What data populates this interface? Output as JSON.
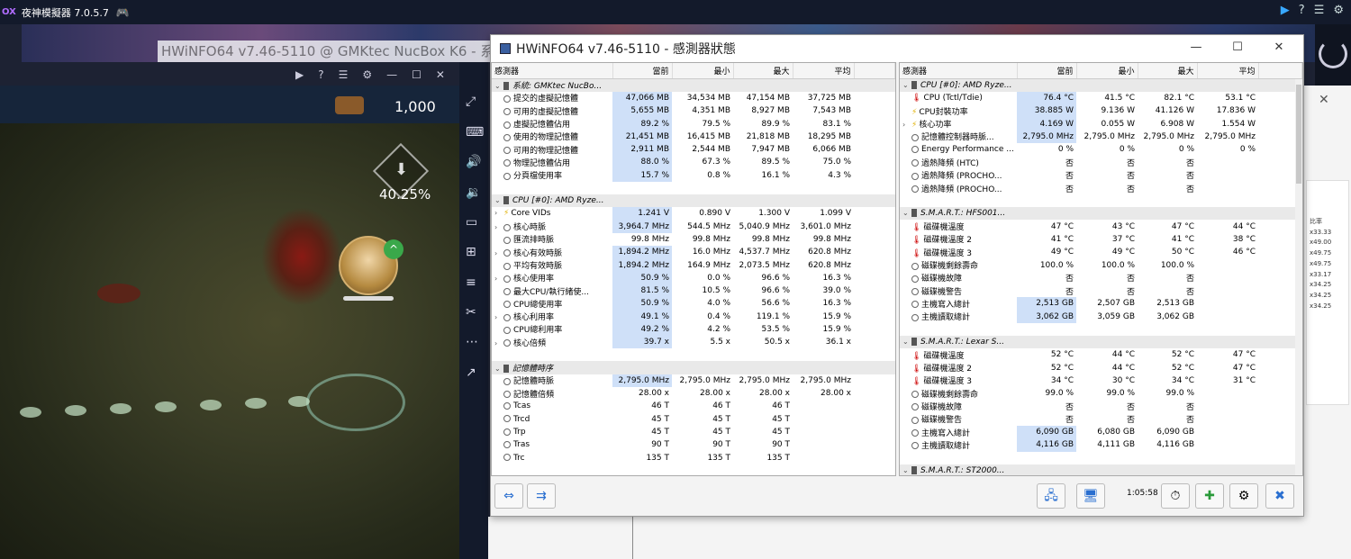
{
  "emulator": {
    "logo": "OX",
    "title": "夜神模擬器 7.0.5.7"
  },
  "game": {
    "gold": "1,000",
    "progress_text": "40.25%"
  },
  "mini_window": {
    "title": "HWiNFO64 v7.46-5110 @ GMKtec NucBox K6 - 系統"
  },
  "hwinfo": {
    "title": "HWiNFO64 v7.46-5110 - 感測器狀態",
    "columns": [
      "感測器",
      "當前",
      "最小",
      "最大",
      "平均"
    ],
    "time": "1:05:58",
    "left_rows": [
      {
        "t": "grp",
        "label": "系統: GMKtec NucBo..."
      },
      {
        "label": "提交的虛擬記憶體",
        "cur": "47,066 MB",
        "min": "34,534 MB",
        "max": "47,154 MB",
        "avg": "37,725 MB",
        "hl": true
      },
      {
        "label": "可用的虛擬記憶體",
        "cur": "5,655 MB",
        "min": "4,351 MB",
        "max": "8,927 MB",
        "avg": "7,543 MB",
        "hl": true
      },
      {
        "label": "虛擬記憶體佔用",
        "cur": "89.2 %",
        "min": "79.5 %",
        "max": "89.9 %",
        "avg": "83.1 %",
        "hl": true
      },
      {
        "label": "使用的物理記憶體",
        "cur": "21,451 MB",
        "min": "16,415 MB",
        "max": "21,818 MB",
        "avg": "18,295 MB",
        "hl": true
      },
      {
        "label": "可用的物理記憶體",
        "cur": "2,911 MB",
        "min": "2,544 MB",
        "max": "7,947 MB",
        "avg": "6,066 MB",
        "hl": true
      },
      {
        "label": "物理記憶體佔用",
        "cur": "88.0 %",
        "min": "67.3 %",
        "max": "89.5 %",
        "avg": "75.0 %",
        "hl": true
      },
      {
        "label": "分頁檔使用率",
        "cur": "15.7 %",
        "min": "0.8 %",
        "max": "16.1 %",
        "avg": "4.3 %",
        "hl": true
      },
      {
        "t": "blank"
      },
      {
        "t": "grp",
        "label": "CPU [#0]: AMD Ryze..."
      },
      {
        "label": "Core VIDs",
        "cur": "1.241 V",
        "min": "0.890 V",
        "max": "1.300 V",
        "avg": "1.099 V",
        "hl": true,
        "exp": true,
        "icon": "bolt"
      },
      {
        "label": "核心時脈",
        "cur": "3,964.7 MHz",
        "min": "544.5 MHz",
        "max": "5,040.9 MHz",
        "avg": "3,601.0 MHz",
        "hl": true,
        "exp": true
      },
      {
        "label": "匯流排時脈",
        "cur": "99.8 MHz",
        "min": "99.8 MHz",
        "max": "99.8 MHz",
        "avg": "99.8 MHz"
      },
      {
        "label": "核心有效時脈",
        "cur": "1,894.2 MHz",
        "min": "16.0 MHz",
        "max": "4,537.7 MHz",
        "avg": "620.8 MHz",
        "hl": true,
        "exp": true
      },
      {
        "label": "平均有效時脈",
        "cur": "1,894.2 MHz",
        "min": "164.9 MHz",
        "max": "2,073.5 MHz",
        "avg": "620.8 MHz",
        "hl": true
      },
      {
        "label": "核心使用率",
        "cur": "50.9 %",
        "min": "0.0 %",
        "max": "96.6 %",
        "avg": "16.3 %",
        "hl": true,
        "exp": true
      },
      {
        "label": "最大CPU/執行緒使...",
        "cur": "81.5 %",
        "min": "10.5 %",
        "max": "96.6 %",
        "avg": "39.0 %",
        "hl": true
      },
      {
        "label": "CPU總使用率",
        "cur": "50.9 %",
        "min": "4.0 %",
        "max": "56.6 %",
        "avg": "16.3 %",
        "hl": true
      },
      {
        "label": "核心利用率",
        "cur": "49.1 %",
        "min": "0.4 %",
        "max": "119.1 %",
        "avg": "15.9 %",
        "hl": true,
        "exp": true
      },
      {
        "label": "CPU總利用率",
        "cur": "49.2 %",
        "min": "4.2 %",
        "max": "53.5 %",
        "avg": "15.9 %",
        "hl": true
      },
      {
        "label": "核心倍頻",
        "cur": "39.7 x",
        "min": "5.5 x",
        "max": "50.5 x",
        "avg": "36.1 x",
        "hl": true,
        "exp": true
      },
      {
        "t": "blank"
      },
      {
        "t": "grp",
        "label": "記憶體時序"
      },
      {
        "label": "記憶體時脈",
        "cur": "2,795.0 MHz",
        "min": "2,795.0 MHz",
        "max": "2,795.0 MHz",
        "avg": "2,795.0 MHz",
        "hl": true
      },
      {
        "label": "記憶體倍頻",
        "cur": "28.00 x",
        "min": "28.00 x",
        "max": "28.00 x",
        "avg": "28.00 x"
      },
      {
        "label": "Tcas",
        "cur": "46 T",
        "min": "46 T",
        "max": "46 T",
        "avg": ""
      },
      {
        "label": "Trcd",
        "cur": "45 T",
        "min": "45 T",
        "max": "45 T",
        "avg": ""
      },
      {
        "label": "Trp",
        "cur": "45 T",
        "min": "45 T",
        "max": "45 T",
        "avg": ""
      },
      {
        "label": "Tras",
        "cur": "90 T",
        "min": "90 T",
        "max": "90 T",
        "avg": ""
      },
      {
        "label": "Trc",
        "cur": "135 T",
        "min": "135 T",
        "max": "135 T",
        "avg": ""
      }
    ],
    "right_rows": [
      {
        "t": "grp",
        "label": "CPU [#0]: AMD Ryze..."
      },
      {
        "label": "CPU (Tctl/Tdie)",
        "cur": "76.4 °C",
        "min": "41.5 °C",
        "max": "82.1 °C",
        "avg": "53.1 °C",
        "hl": true,
        "icon": "therm"
      },
      {
        "label": "CPU封裝功率",
        "cur": "38.885 W",
        "min": "9.136 W",
        "max": "41.126 W",
        "avg": "17.836 W",
        "hl": true,
        "icon": "bolt"
      },
      {
        "label": "核心功率",
        "cur": "4.169 W",
        "min": "0.055 W",
        "max": "6.908 W",
        "avg": "1.554 W",
        "hl": true,
        "exp": true,
        "icon": "bolt"
      },
      {
        "label": "記憶體控制器時脈...",
        "cur": "2,795.0 MHz",
        "min": "2,795.0 MHz",
        "max": "2,795.0 MHz",
        "avg": "2,795.0 MHz",
        "hl": true
      },
      {
        "label": "Energy Performance ...",
        "cur": "0 %",
        "min": "0 %",
        "max": "0 %",
        "avg": "0 %"
      },
      {
        "label": "過熱降頻 (HTC)",
        "cur": "否",
        "min": "否",
        "max": "否",
        "avg": ""
      },
      {
        "label": "過熱降頻 (PROCHO...",
        "cur": "否",
        "min": "否",
        "max": "否",
        "avg": ""
      },
      {
        "label": "過熱降頻 (PROCHO...",
        "cur": "否",
        "min": "否",
        "max": "否",
        "avg": ""
      },
      {
        "t": "blank"
      },
      {
        "t": "grp",
        "label": "S.M.A.R.T.: HFS001..."
      },
      {
        "label": "磁碟機溫度",
        "cur": "47 °C",
        "min": "43 °C",
        "max": "47 °C",
        "avg": "44 °C",
        "icon": "therm"
      },
      {
        "label": "磁碟機溫度 2",
        "cur": "41 °C",
        "min": "37 °C",
        "max": "41 °C",
        "avg": "38 °C",
        "icon": "therm"
      },
      {
        "label": "磁碟機溫度 3",
        "cur": "49 °C",
        "min": "49 °C",
        "max": "50 °C",
        "avg": "46 °C",
        "icon": "therm"
      },
      {
        "label": "磁碟機剩餘壽命",
        "cur": "100.0 %",
        "min": "100.0 %",
        "max": "100.0 %",
        "avg": ""
      },
      {
        "label": "磁碟機故障",
        "cur": "否",
        "min": "否",
        "max": "否",
        "avg": ""
      },
      {
        "label": "磁碟機警告",
        "cur": "否",
        "min": "否",
        "max": "否",
        "avg": ""
      },
      {
        "label": "主機寫入總計",
        "cur": "2,513 GB",
        "min": "2,507 GB",
        "max": "2,513 GB",
        "avg": "",
        "hl": true
      },
      {
        "label": "主機讀取總計",
        "cur": "3,062 GB",
        "min": "3,059 GB",
        "max": "3,062 GB",
        "avg": "",
        "hl": true
      },
      {
        "t": "blank"
      },
      {
        "t": "grp",
        "label": "S.M.A.R.T.: Lexar S..."
      },
      {
        "label": "磁碟機溫度",
        "cur": "52 °C",
        "min": "44 °C",
        "max": "52 °C",
        "avg": "47 °C",
        "icon": "therm"
      },
      {
        "label": "磁碟機溫度 2",
        "cur": "52 °C",
        "min": "44 °C",
        "max": "52 °C",
        "avg": "47 °C",
        "icon": "therm"
      },
      {
        "label": "磁碟機溫度 3",
        "cur": "34 °C",
        "min": "30 °C",
        "max": "34 °C",
        "avg": "31 °C",
        "icon": "therm"
      },
      {
        "label": "磁碟機剩餘壽命",
        "cur": "99.0 %",
        "min": "99.0 %",
        "max": "99.0 %",
        "avg": ""
      },
      {
        "label": "磁碟機故障",
        "cur": "否",
        "min": "否",
        "max": "否",
        "avg": ""
      },
      {
        "label": "磁碟機警告",
        "cur": "否",
        "min": "否",
        "max": "否",
        "avg": ""
      },
      {
        "label": "主機寫入總計",
        "cur": "6,090 GB",
        "min": "6,080 GB",
        "max": "6,090 GB",
        "avg": "",
        "hl": true
      },
      {
        "label": "主機讀取總計",
        "cur": "4,116 GB",
        "min": "4,111 GB",
        "max": "4,116 GB",
        "avg": "",
        "hl": true
      },
      {
        "t": "blank"
      },
      {
        "t": "grp",
        "label": "S.M.A.R.T.: ST2000..."
      }
    ]
  },
  "right_panel": {
    "header": "比率",
    "ratios": [
      "x33.33",
      "x49.00",
      "x49.75",
      "x49.75",
      "x33.17",
      "x34.25",
      "x34.25",
      "x34.25"
    ]
  }
}
